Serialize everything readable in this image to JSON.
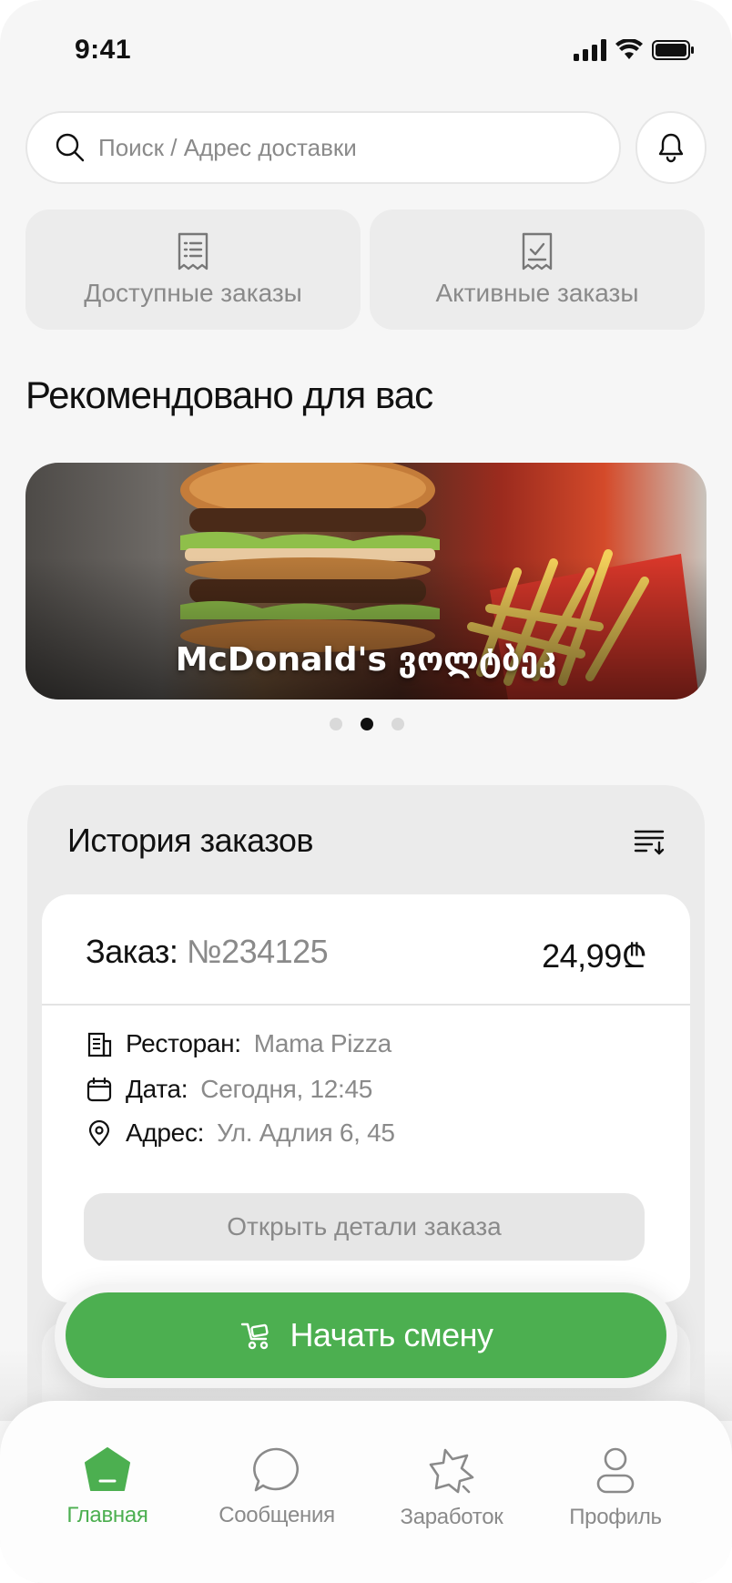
{
  "status_bar": {
    "time": "9:41"
  },
  "search": {
    "placeholder": "Поиск / Адрес доставки"
  },
  "tiles": [
    {
      "label": "Доступные заказы",
      "icon": "receipt-icon"
    },
    {
      "label": "Активные заказы",
      "icon": "receipt-check-icon"
    }
  ],
  "recommended": {
    "title": "Рекомендовано для вас",
    "banner_text": "McDonald's ვოლტბეკ",
    "pagination": {
      "total": 3,
      "active": 2
    }
  },
  "history": {
    "title": "История заказов",
    "order": {
      "prefix": "Заказ:",
      "number": "№234125",
      "price": "24,99₾",
      "restaurant_label": "Ресторан:",
      "restaurant_value": "Mama Pizza",
      "date_label": "Дата:",
      "date_value": "Сегодня, 12:45",
      "address_label": "Адрес:",
      "address_value": "Ул. Адлия 6, 45",
      "details_button": "Открыть детали заказа"
    }
  },
  "shift_button": "Начать смену",
  "nav": {
    "items": [
      {
        "label": "Главная",
        "icon": "home-icon",
        "active": true
      },
      {
        "label": "Сообщения",
        "icon": "chat-icon",
        "active": false
      },
      {
        "label": "Заработок",
        "icon": "star-icon",
        "active": false
      },
      {
        "label": "Профиль",
        "icon": "user-icon",
        "active": false
      }
    ]
  },
  "colors": {
    "accent": "#4caf50",
    "background": "#f6f6f6",
    "muted_text": "#8a8a8a"
  }
}
